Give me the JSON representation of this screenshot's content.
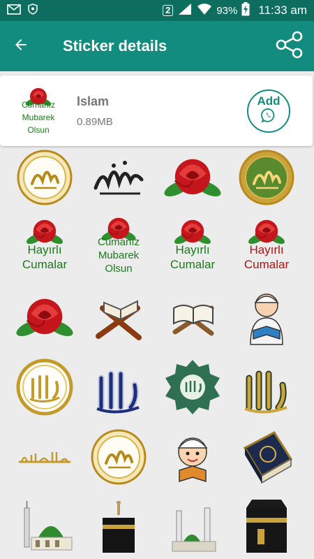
{
  "status_bar": {
    "sim_slot": "2",
    "battery_percent": "93%",
    "time": "11:33 am",
    "icons": [
      "mail-icon",
      "shield-icon",
      "signal-icon",
      "wifi-icon",
      "battery-charging-icon"
    ]
  },
  "app_bar": {
    "title": "Sticker details",
    "back_icon": "arrow-back-icon",
    "share_icon": "share-icon"
  },
  "pack": {
    "name": "Islam",
    "size": "0.89MB",
    "tray_text": [
      "Cumanız",
      "Mubarek",
      "Olsun"
    ],
    "add_label": "Add",
    "add_icon": "whatsapp-icon"
  },
  "stickers": [
    {
      "kind": "medallion-muhammad"
    },
    {
      "kind": "calligraphy-muhammad"
    },
    {
      "kind": "red-rose"
    },
    {
      "kind": "medallion-muhammad-gold"
    },
    {
      "kind": "rose-text",
      "lines": [
        "Hayırlı",
        "Cumalar"
      ],
      "color": "green"
    },
    {
      "kind": "rose-text",
      "lines": [
        "Cumanız",
        "Mubarek",
        "Olsun"
      ],
      "color": "green"
    },
    {
      "kind": "rose-text",
      "lines": [
        "Hayırlı",
        "Cumalar"
      ],
      "color": "green"
    },
    {
      "kind": "rose-text",
      "lines": [
        "Hayırlı",
        "Cumalar"
      ],
      "color": "red"
    },
    {
      "kind": "red-rose"
    },
    {
      "kind": "quran-stand"
    },
    {
      "kind": "open-book"
    },
    {
      "kind": "boy-reading"
    },
    {
      "kind": "medallion-allah"
    },
    {
      "kind": "calligraphy-allah-blue"
    },
    {
      "kind": "green-medallion"
    },
    {
      "kind": "calligraphy-allah-gold"
    },
    {
      "kind": "bismillah"
    },
    {
      "kind": "medallion-muhammad"
    },
    {
      "kind": "boy-cartoon"
    },
    {
      "kind": "quran-book"
    },
    {
      "kind": "green-dome-mosque"
    },
    {
      "kind": "kaaba"
    },
    {
      "kind": "mosque-minaret"
    },
    {
      "kind": "kaaba-close"
    }
  ]
}
